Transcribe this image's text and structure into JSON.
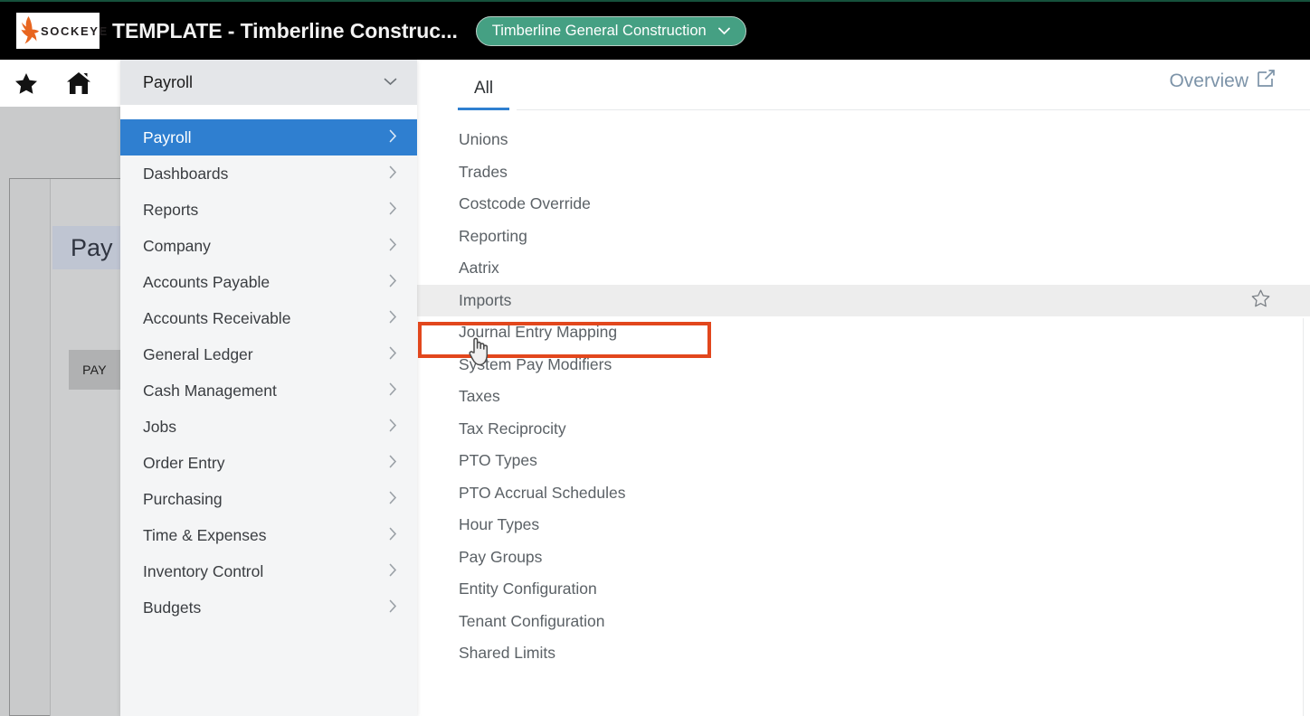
{
  "topbar": {
    "logo_word": "SOCKEYE",
    "logo_icon": "sockeye-salmon-logo",
    "app_title": "TEMPLATE - Timberline Construc...",
    "company_selector": {
      "label": "Timberline General Construction",
      "icon": "chevron-down-icon",
      "color": "#45a083"
    },
    "background_color": "#000000"
  },
  "icon_rail": {
    "items": [
      {
        "name": "favorites-star-icon",
        "label": "Favorites"
      },
      {
        "name": "home-icon",
        "label": "Home"
      }
    ]
  },
  "nav_panel": {
    "header": {
      "label": "Payroll",
      "icon": "chevron-down-icon"
    },
    "active_color": "#2f7fd0",
    "items": [
      {
        "label": "Payroll",
        "active": true
      },
      {
        "label": "Dashboards",
        "active": false
      },
      {
        "label": "Reports",
        "active": false
      },
      {
        "label": "Company",
        "active": false
      },
      {
        "label": "Accounts Payable",
        "active": false
      },
      {
        "label": "Accounts Receivable",
        "active": false
      },
      {
        "label": "General Ledger",
        "active": false
      },
      {
        "label": "Cash Management",
        "active": false
      },
      {
        "label": "Jobs",
        "active": false
      },
      {
        "label": "Order Entry",
        "active": false
      },
      {
        "label": "Purchasing",
        "active": false
      },
      {
        "label": "Time & Expenses",
        "active": false
      },
      {
        "label": "Inventory Control",
        "active": false
      },
      {
        "label": "Budgets",
        "active": false
      }
    ]
  },
  "content_panel": {
    "tabs": [
      {
        "label": "All",
        "active": true
      }
    ],
    "overview_link": {
      "label": "Overview",
      "icon": "external-link-icon"
    },
    "menu_items": [
      {
        "label": "Unions",
        "highlighted": false
      },
      {
        "label": "Trades",
        "highlighted": false
      },
      {
        "label": "Costcode Override",
        "highlighted": false
      },
      {
        "label": "Reporting",
        "highlighted": false
      },
      {
        "label": "Aatrix",
        "highlighted": false
      },
      {
        "label": "Imports",
        "highlighted": true
      },
      {
        "label": "Journal Entry Mapping",
        "highlighted": false
      },
      {
        "label": "System Pay Modifiers",
        "highlighted": false
      },
      {
        "label": "Taxes",
        "highlighted": false
      },
      {
        "label": "Tax Reciprocity",
        "highlighted": false
      },
      {
        "label": "PTO Types",
        "highlighted": false
      },
      {
        "label": "PTO Accrual Schedules",
        "highlighted": false
      },
      {
        "label": "Hour Types",
        "highlighted": false
      },
      {
        "label": "Pay Groups",
        "highlighted": false
      },
      {
        "label": "Entity Configuration",
        "highlighted": false
      },
      {
        "label": "Tenant Configuration",
        "highlighted": false
      },
      {
        "label": "Shared Limits",
        "highlighted": false
      }
    ],
    "favorite_icon": "star-outline-icon"
  },
  "annotation": {
    "target_label": "Imports",
    "color": "#e2471d",
    "shape": "rectangle-highlight"
  },
  "cursor": {
    "type": "pointer-hand-cursor"
  },
  "background_page": {
    "heading": "Pay",
    "button_label": "PAY",
    "dimmed": true
  }
}
